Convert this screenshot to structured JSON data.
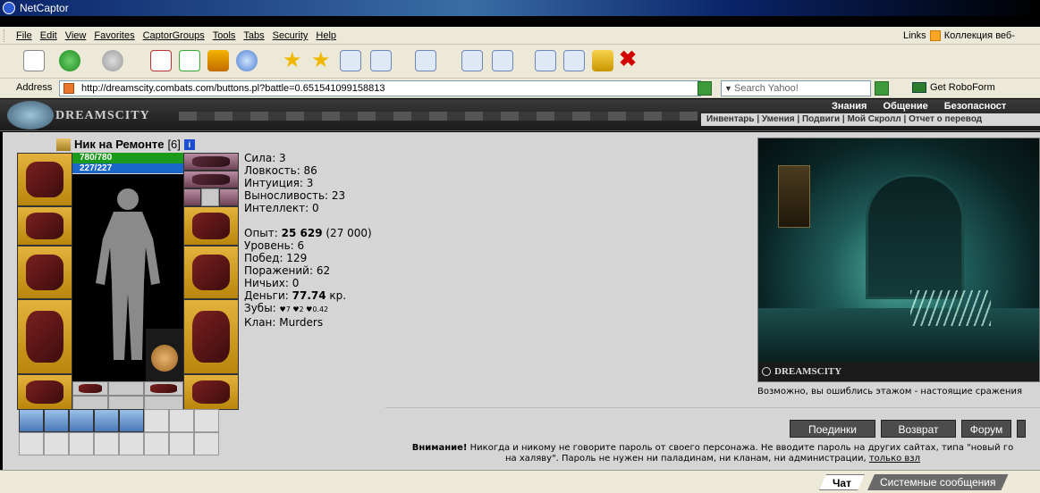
{
  "window": {
    "title": "NetCaptor"
  },
  "menu": {
    "items": [
      "File",
      "Edit",
      "View",
      "Favorites",
      "CaptorGroups",
      "Tools",
      "Tabs",
      "Security",
      "Help"
    ],
    "links_label": "Links",
    "links_item": "Коллекция веб-"
  },
  "address": {
    "label": "Address",
    "url": "http://dreamscity.combats.com/buttons.pl?battle=0.651541099158813",
    "search_placeholder": "Search Yahoo!",
    "roboform": "Get RoboForm"
  },
  "game_header": {
    "brand": "DREAMSCITY",
    "top_links": [
      "Знания",
      "Общение",
      "Безопасност"
    ],
    "sub_nav": "Инвентарь | Умения | Подвиги | Мой Скролл | Отчет о перевод"
  },
  "character": {
    "name": "Ник на Ремонте",
    "level": "[6]",
    "hp": "780/780",
    "mp": "227/227"
  },
  "stats": {
    "strength": "Сила: 3",
    "agility": "Ловкость: 86",
    "intuition": "Интуиция: 3",
    "endurance": "Выносливость: 23",
    "intellect": "Интеллект: 0",
    "exp_label": "Опыт: ",
    "exp_value": "25 629",
    "exp_next": " (27 000)",
    "level": "Уровень: 6",
    "wins": "Побед: 129",
    "losses": "Поражений: 62",
    "draws": "Ничьих: 0",
    "money_label": "Деньги: ",
    "money_value": "77.74",
    "money_unit": " кр.",
    "teeth_label": "Зубы: ",
    "teeth_values": "♥7 ♥2 ♥0.42",
    "clan": "Клан: Murders"
  },
  "scene": {
    "caption": "DREAMSCITY",
    "hint": "Возможно, вы ошиблись этажом - настоящие сражения"
  },
  "buttons": {
    "duels": "Поединки",
    "return": "Возврат",
    "forum": "Форум"
  },
  "warning": {
    "bold": "Внимание!",
    "text1": " Никогда и никому не говорите пароль от своего персонажа. Не вводите пароль на других сайтах, типа \"новый го",
    "text2": "на халяву\". Пароль не нужен ни паладинам, ни кланам, ни администрации, ",
    "link": "только взл"
  },
  "chat": {
    "tab_chat": "Чат",
    "tab_system": "Системные сообщения"
  },
  "colors": {
    "hp": "#1c9a1c",
    "mp": "#1b66c9",
    "panel": "#d5d5d5"
  }
}
